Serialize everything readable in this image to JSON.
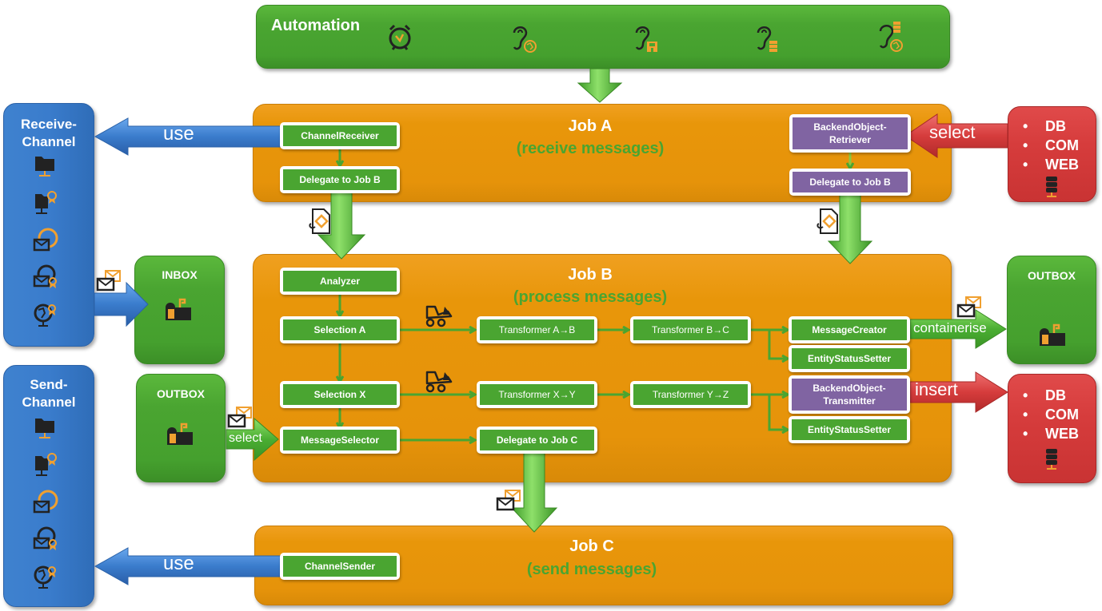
{
  "automation": {
    "title": "Automation",
    "icons": [
      "alarm-clock-icon",
      "ear-web-icon",
      "ear-floppy-icon",
      "ear-database-icon",
      "ear-database-web-icon"
    ]
  },
  "receive_channel": {
    "title_line1": "Receive-",
    "title_line2": "Channel",
    "icons": [
      "network-folder-icon",
      "network-folder-certificate-icon",
      "web-mail-icon",
      "web-mail-certificate-icon",
      "network-globe-certificate-icon"
    ],
    "arrow_label": "use"
  },
  "send_channel": {
    "title_line1": "Send-",
    "title_line2": "Channel",
    "icons": [
      "network-folder-icon",
      "network-folder-certificate-icon",
      "web-mail-icon",
      "web-mail-certificate-icon",
      "network-globe-certificate-icon"
    ],
    "arrow_label": "use"
  },
  "inbox": {
    "title": "INBOX"
  },
  "outbox_left": {
    "title": "OUTBOX",
    "arrow_label": "select"
  },
  "outbox_right": {
    "title": "OUTBOX",
    "arrow_label": "containerise"
  },
  "backend_top": {
    "items": [
      "DB",
      "COM",
      "WEB"
    ],
    "arrow_label": "select"
  },
  "backend_bottom": {
    "items": [
      "DB",
      "COM",
      "WEB"
    ],
    "arrow_label": "insert"
  },
  "job_a": {
    "title": "Job A",
    "subtitle": "(receive messages)",
    "nodes": {
      "channel_receiver": "ChannelReceiver",
      "delegate_left": "Delegate to Job B",
      "backend_retriever_line1": "BackendObject-",
      "backend_retriever_line2": "Retriever",
      "delegate_right": "Delegate to Job B"
    }
  },
  "job_b": {
    "title": "Job B",
    "subtitle": "(process messages)",
    "nodes": {
      "analyzer": "Analyzer",
      "selection_a": "Selection A",
      "selection_x": "Selection X",
      "message_selector": "MessageSelector",
      "transformer_ab": "Transformer A→B",
      "transformer_bc": "Transformer B→C",
      "transformer_xy": "Transformer X→Y",
      "transformer_yz": "Transformer Y→Z",
      "delegate_c": "Delegate to Job C",
      "message_creator": "MessageCreator",
      "entity_status_setter_1": "EntityStatusSetter",
      "backend_transmitter_line1": "BackendObject-",
      "backend_transmitter_line2": "Transmitter",
      "entity_status_setter_2": "EntityStatusSetter"
    }
  },
  "job_c": {
    "title": "Job C",
    "subtitle": "(send messages)",
    "nodes": {
      "channel_sender": "ChannelSender"
    }
  },
  "colors": {
    "job_orange": "#e8960a",
    "green": "#4aa531",
    "blue": "#3a7ccc",
    "red": "#d63c3c",
    "purple": "#8064a2",
    "icon_orange": "#f0a030",
    "icon_dark": "#222222"
  }
}
